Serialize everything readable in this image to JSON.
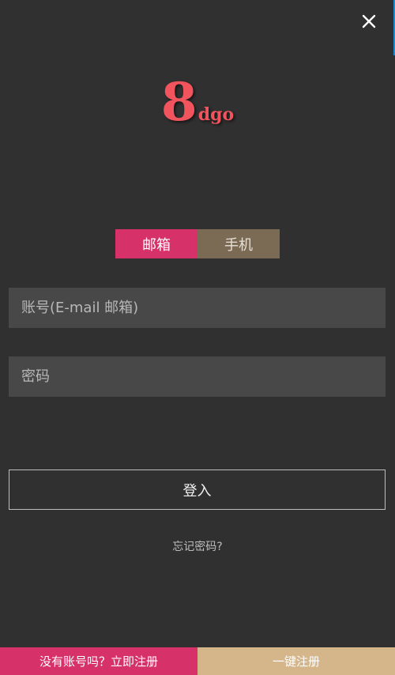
{
  "logo": {
    "number": "8",
    "text": "dgo"
  },
  "close": {
    "icon": "close-icon"
  },
  "tabs": [
    {
      "label": "邮箱",
      "active": true
    },
    {
      "label": "手机",
      "active": false
    }
  ],
  "form": {
    "account_placeholder": "账号(E-mail 邮箱)",
    "password_placeholder": "密码",
    "login_label": "登入",
    "forgot_label": "忘记密码?"
  },
  "footer": {
    "register_prompt": "没有账号吗？立即注册",
    "quick_register": "一键注册"
  },
  "colors": {
    "background": "#303030",
    "accent_pink": "#d63169",
    "accent_brown": "#7b6a54",
    "accent_tan": "#d4b68a",
    "logo_red": "#f2545e"
  }
}
